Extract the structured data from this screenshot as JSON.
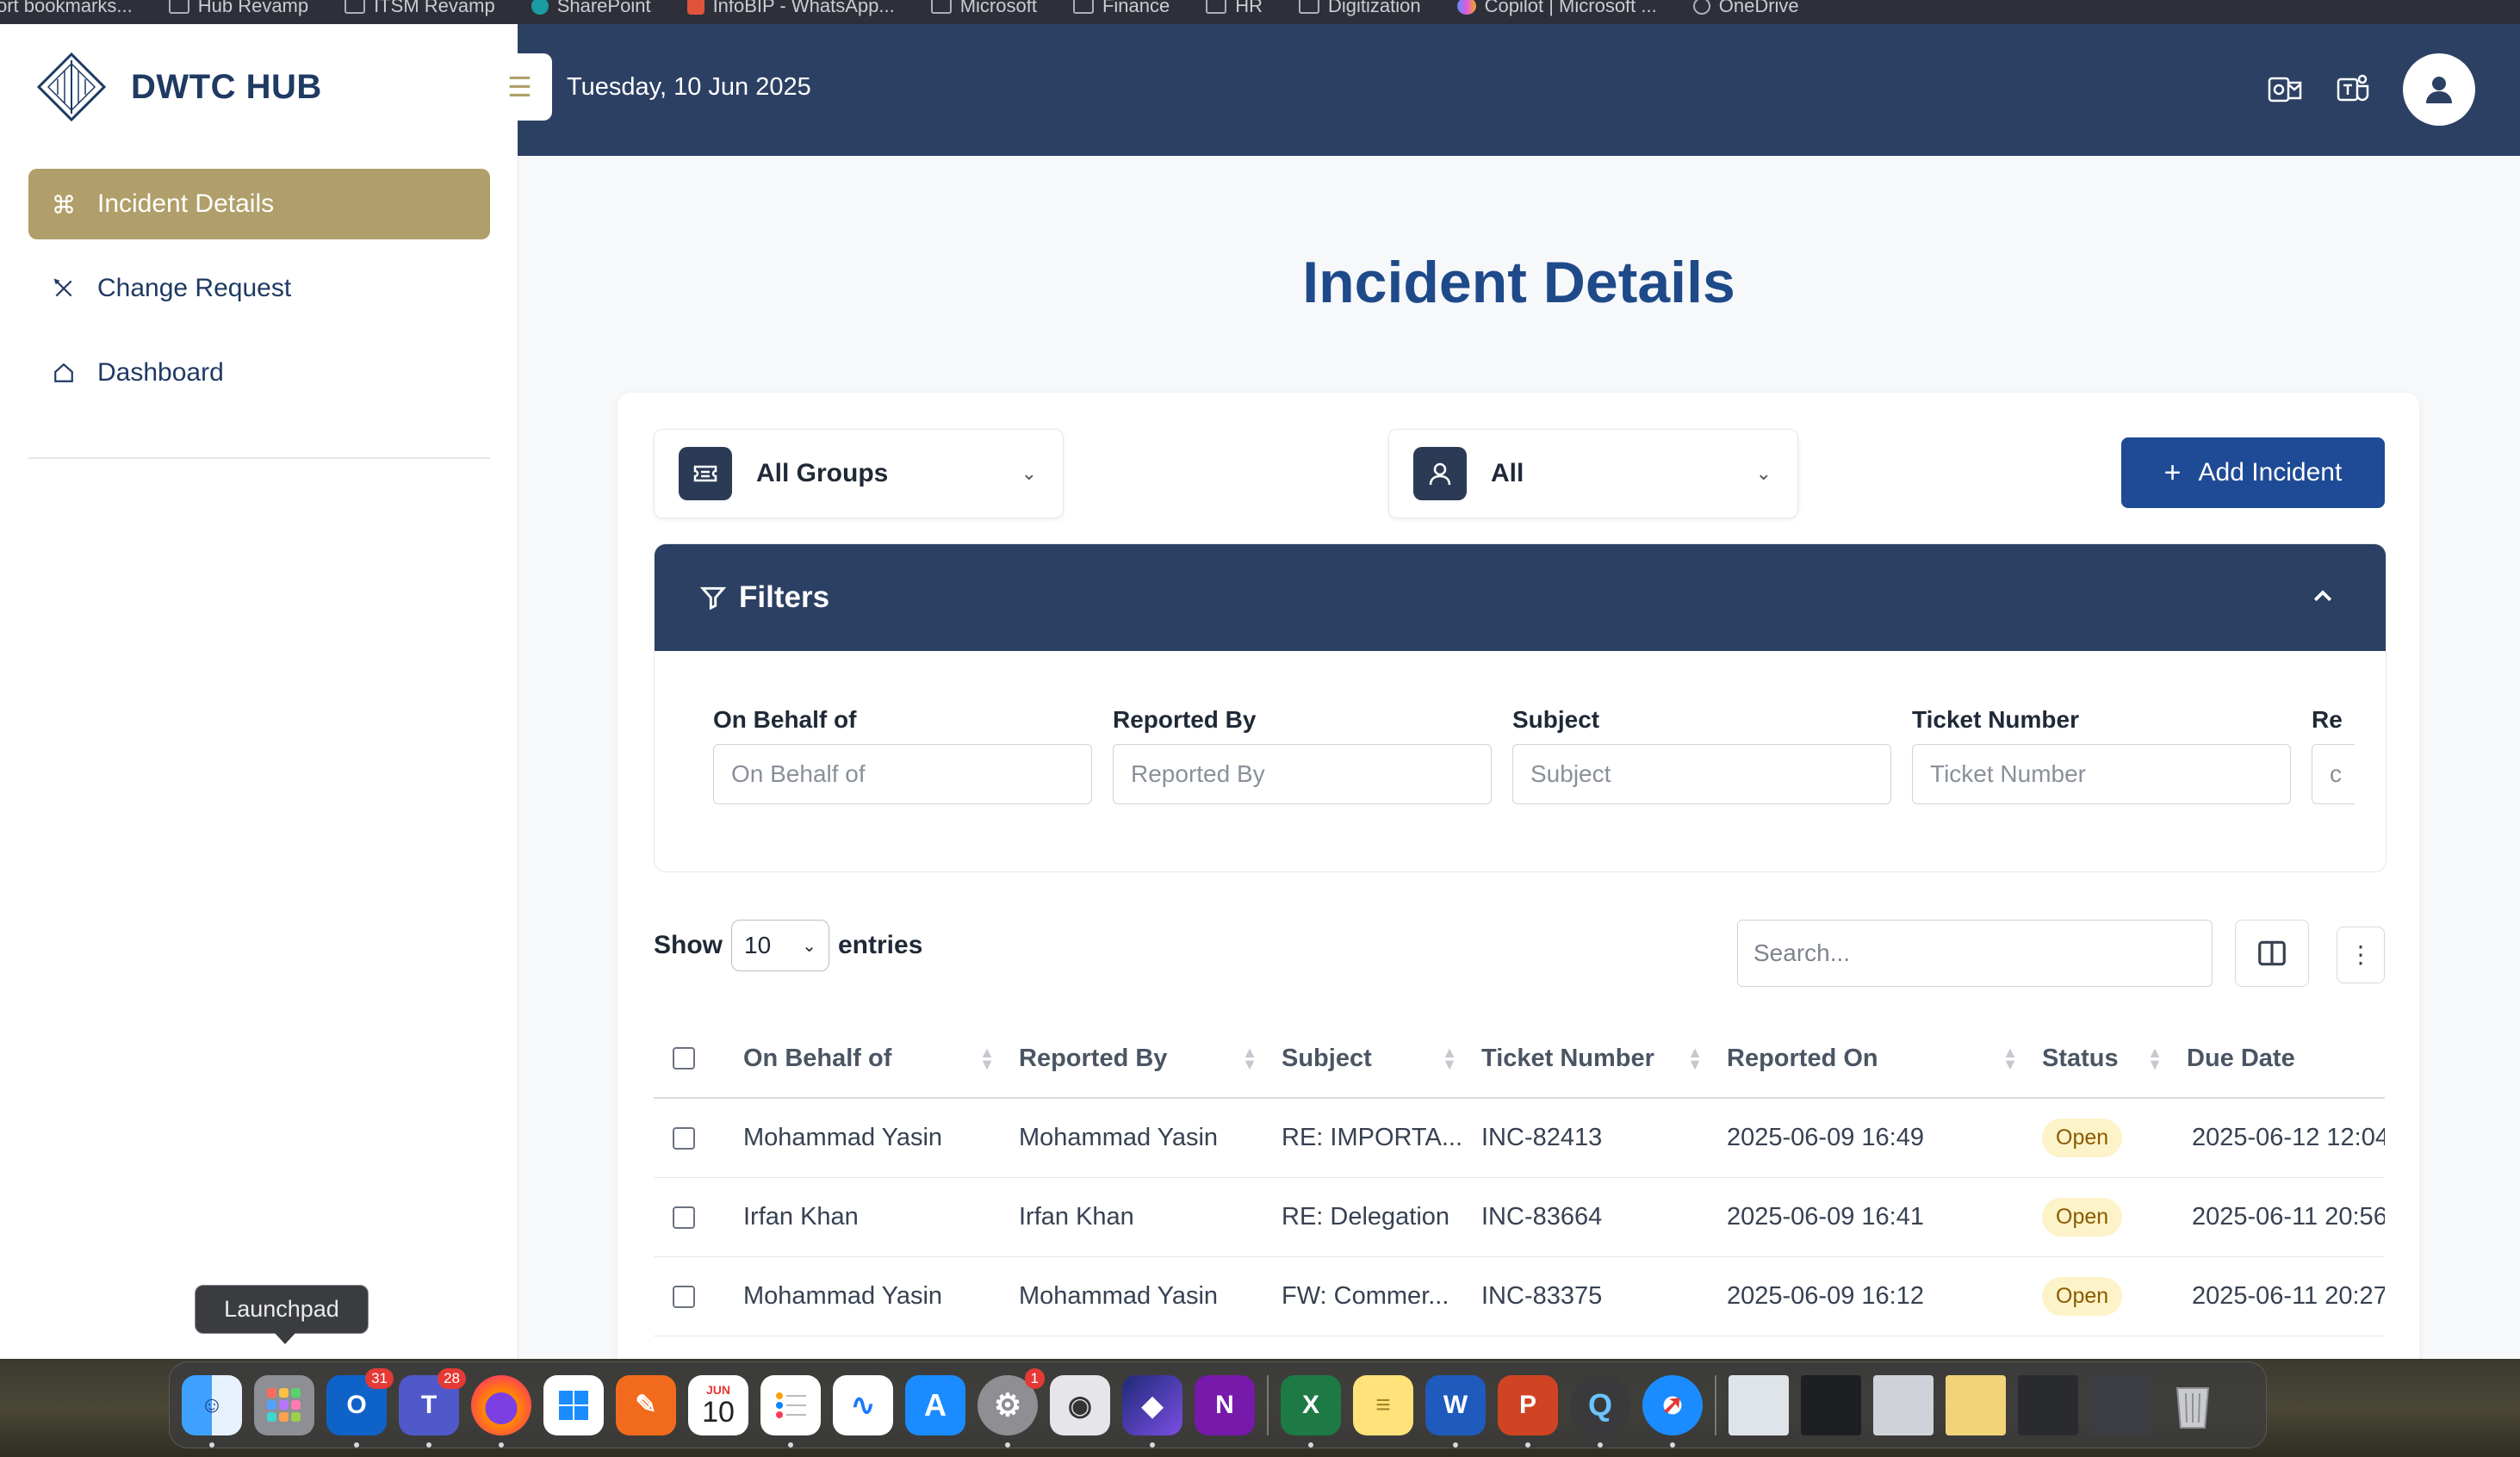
{
  "browser": {
    "bookmarks": [
      "ort bookmarks...",
      "Hub Revamp",
      "ITSM Revamp",
      "SharePoint",
      "InfoBIP - WhatsApp...",
      "Microsoft",
      "Finance",
      "HR",
      "Digitization",
      "Copilot | Microsoft ...",
      "OneDrive"
    ]
  },
  "brand": {
    "name": "DWTC HUB"
  },
  "sidebar": {
    "items": [
      {
        "label": "Incident Details",
        "icon": "command-icon",
        "active": true
      },
      {
        "label": "Change Request",
        "icon": "tools-icon",
        "active": false
      },
      {
        "label": "Dashboard",
        "icon": "home-icon",
        "active": false
      }
    ]
  },
  "header": {
    "date": "Tuesday, 10 Jun 2025"
  },
  "page": {
    "title": "Incident Details"
  },
  "toolbar": {
    "group_select": "All Groups",
    "user_select": "All",
    "add_label": "Add Incident"
  },
  "filters": {
    "title": "Filters",
    "fields": [
      {
        "label": "On Behalf of",
        "placeholder": "On Behalf of"
      },
      {
        "label": "Reported By",
        "placeholder": "Reported By"
      },
      {
        "label": "Subject",
        "placeholder": "Subject"
      },
      {
        "label": "Ticket Number",
        "placeholder": "Ticket Number"
      },
      {
        "label": "Re",
        "placeholder": "c"
      }
    ]
  },
  "list_controls": {
    "show_label": "Show",
    "page_size": "10",
    "entries_label": "entries",
    "search_placeholder": "Search..."
  },
  "table": {
    "columns": [
      "On Behalf of",
      "Reported By",
      "Subject",
      "Ticket Number",
      "Reported On",
      "Status",
      "Due Date"
    ],
    "rows": [
      {
        "on_behalf": "Mohammad Yasin",
        "reported_by": "Mohammad Yasin",
        "subject": "RE: IMPORTA...",
        "ticket": "INC-82413",
        "reported_on": "2025-06-09 16:49",
        "status": "Open",
        "due": "2025-06-12 12:04"
      },
      {
        "on_behalf": "Irfan Khan",
        "reported_by": "Irfan Khan",
        "subject": "RE: Delegation",
        "ticket": "INC-83664",
        "reported_on": "2025-06-09 16:41",
        "status": "Open",
        "due": "2025-06-11 20:56"
      },
      {
        "on_behalf": "Mohammad Yasin",
        "reported_by": "Mohammad Yasin",
        "subject": "FW: Commer...",
        "ticket": "INC-83375",
        "reported_on": "2025-06-09 16:12",
        "status": "Open",
        "due": "2025-06-11 20:27"
      }
    ]
  },
  "tooltip": {
    "text": "Launchpad"
  },
  "dock": {
    "calendar_month": "JUN",
    "calendar_day": "10",
    "outlook_badge": "31",
    "teams_badge": "28",
    "settings_badge": "1"
  },
  "colors": {
    "navy": "#2c4063",
    "gold": "#b09f6a",
    "primary_button": "#1f4a96",
    "title_blue": "#1e4a8a",
    "status_open_bg": "#fdf3c8",
    "due_dot": "#2fb52c"
  }
}
